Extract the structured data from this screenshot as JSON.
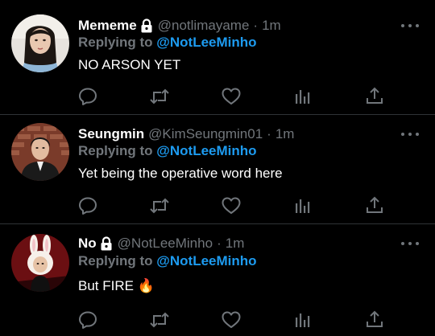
{
  "tweets": [
    {
      "name": "Mememe",
      "handle": "@notlimayame",
      "separator": "·",
      "time": "1m",
      "reply_prefix": "Replying to",
      "reply_to": "@NotLeeMinho",
      "text": "NO ARSON YET",
      "protected": true
    },
    {
      "name": "Seungmin",
      "handle": "@KimSeungmin01",
      "separator": "·",
      "time": "1m",
      "reply_prefix": "Replying to",
      "reply_to": "@NotLeeMinho",
      "text": "Yet being the operative word here",
      "protected": false
    },
    {
      "name": "No",
      "handle": "@NotLeeMinho",
      "separator": "·",
      "time": "1m",
      "reply_prefix": "Replying to",
      "reply_to": "@NotLeeMinho",
      "text": "But FIRE 🔥",
      "protected": true
    }
  ],
  "colors": {
    "background": "#000000",
    "muted": "#71767b",
    "link": "#1d9bf0",
    "divider": "#2f3336",
    "text": "#ffffff"
  },
  "icons": {
    "reply": "reply-icon",
    "retweet": "retweet-icon",
    "like": "heart-icon",
    "stats": "stats-icon",
    "share": "share-icon",
    "lock": "lock-icon",
    "more": "more-icon"
  }
}
